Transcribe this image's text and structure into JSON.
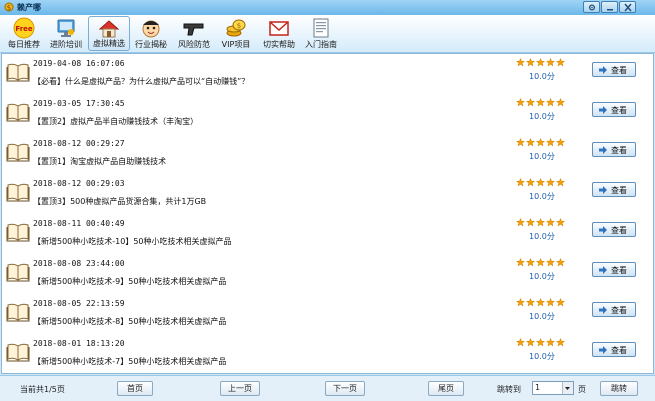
{
  "window": {
    "title": "赖产哪",
    "accent": "#6cb8ea"
  },
  "toolbar": {
    "items": [
      {
        "label": "每日推荐",
        "icon": "free-badge-icon"
      },
      {
        "label": "进阶培训",
        "icon": "monitor-tools-icon"
      },
      {
        "label": "虚拟精选",
        "icon": "house-icon",
        "active": true
      },
      {
        "label": "行业揭秘",
        "icon": "face-icon"
      },
      {
        "label": "风险防范",
        "icon": "pistol-icon"
      },
      {
        "label": "VIP项目",
        "icon": "gold-coins-icon"
      },
      {
        "label": "切实帮助",
        "icon": "envelope-icon"
      },
      {
        "label": "入门指南",
        "icon": "document-icon"
      }
    ]
  },
  "list": {
    "items": [
      {
        "date": "2019-04-08 16:07:06",
        "title": "【必看】什么是虚拟产品？为什么虚拟产品可以“自动赚钱”？",
        "rating": 5,
        "score": "10.0分",
        "button": "查看"
      },
      {
        "date": "2019-03-05 17:30:45",
        "title": "【置顶2】虚拟产品半自动赚钱技术（丰淘宝）",
        "rating": 5,
        "score": "10.0分",
        "button": "查看"
      },
      {
        "date": "2018-08-12 00:29:27",
        "title": "【置顶1】淘宝虚拟产品自助赚钱技术",
        "rating": 5,
        "score": "10.0分",
        "button": "查看"
      },
      {
        "date": "2018-08-12 00:29:03",
        "title": "【置顶3】500种虚拟产品货源合集，共计1万GB",
        "rating": 5,
        "score": "10.0分",
        "button": "查看"
      },
      {
        "date": "2018-08-11 00:40:49",
        "title": "【新增500种小吃技术-10】50种小吃技术相关虚拟产品",
        "rating": 5,
        "score": "10.0分",
        "button": "查看"
      },
      {
        "date": "2018-08-08 23:44:00",
        "title": "【新增500种小吃技术-9】50种小吃技术相关虚拟产品",
        "rating": 5,
        "score": "10.0分",
        "button": "查看"
      },
      {
        "date": "2018-08-05 22:13:59",
        "title": "【新增500种小吃技术-8】50种小吃技术相关虚拟产品",
        "rating": 5,
        "score": "10.0分",
        "button": "查看"
      },
      {
        "date": "2018-08-01 18:13:20",
        "title": "【新增500种小吃技术-7】50种小吃技术相关虚拟产品",
        "rating": 5,
        "score": "10.0分",
        "button": "查看"
      }
    ]
  },
  "footer": {
    "page_info": "当前共1/5页",
    "first": "首页",
    "prev": "上一页",
    "next": "下一页",
    "last": "尾页",
    "jump_label": "跳转到",
    "page_value": "1",
    "page_unit": "页",
    "jump_button": "跳转"
  }
}
